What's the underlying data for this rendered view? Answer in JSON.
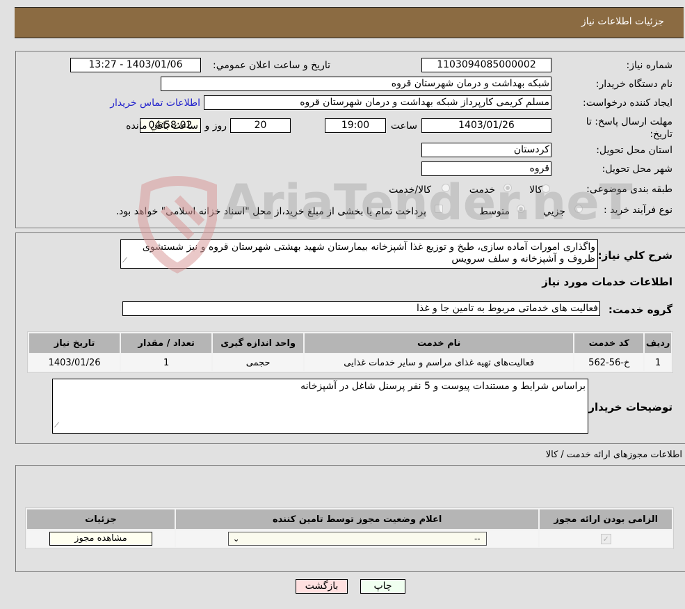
{
  "header": {
    "title": "جزئیات اطلاعات نیاز"
  },
  "details": {
    "need_number_label": "شماره نیاز:",
    "need_number": "1103094085000002",
    "announce_label": "تاریخ و ساعت اعلان عمومي:",
    "announce_value": "1403/01/06 - 13:27",
    "buyer_org_label": "نام دستگاه خریدار:",
    "buyer_org": "شبکه بهداشت و درمان شهرستان قروه",
    "requester_label": "ایجاد کننده درخواست:",
    "requester": "مسلم کریمی کارپرداز شبکه بهداشت و درمان شهرستان قروه",
    "contact_link": "اطلاعات تماس خریدار",
    "deadline_label": "مهلت ارسال پاسخ: تا تاریخ:",
    "deadline_date": "1403/01/26",
    "time_label": "ساعت",
    "deadline_time": "19:00",
    "days_value": "20",
    "days_label": "روز و",
    "remaining_time": "04:58:02",
    "remaining_label": "ساعت باقي مانده",
    "province_label": "استان محل تحویل:",
    "province": "کردستان",
    "city_label": "شهر محل تحویل:",
    "city": "قروه",
    "category_label": "طبقه بندی موضوعی:",
    "category_options": [
      {
        "label": "کالا",
        "checked": false
      },
      {
        "label": "خدمت",
        "checked": true
      },
      {
        "label": "کالا/خدمت",
        "checked": false
      }
    ],
    "process_label": "نوع فرآیند خرید :",
    "process_options": [
      {
        "label": "جزیي",
        "checked": false
      },
      {
        "label": "متوسط",
        "checked": true
      }
    ],
    "treasury_note": "پرداخت تمام یا بخشی از مبلغ خرید،از محل \"اسناد خزانه اسلامی\" خواهد بود.",
    "treasury_checked": false
  },
  "description": {
    "label": "شرح كلي نياز:",
    "text": "واگذاری امورات آماده سازی، طبخ و توزیع غذا آشپزخانه بیمارستان شهید بهشتی شهرستان قروه و نیز شستشوی ظروف و آشپزخانه و سلف سرویس"
  },
  "services": {
    "section_title": "اطلاعات خدمات مورد نیاز",
    "group_label": "گروه خدمت:",
    "group_value": "فعالیت های خدماتی مربوط به تامین جا و غذا",
    "columns": [
      "ردیف",
      "کد خدمت",
      "نام خدمت",
      "واحد اندازه گیری",
      "تعداد / مقدار",
      "تاریخ نیاز"
    ],
    "rows": [
      [
        "1",
        "خ-56-562",
        "فعالیت‌های تهیه غذای مراسم و سایر خدمات غذایی",
        "حجمی",
        "1",
        "1403/01/26"
      ]
    ]
  },
  "buyer_notes": {
    "label": "توضیحات خریدار:",
    "text": "براساس شرایط و مستندات پیوست و 5 نفر پرسنل شاغل در آشپزخانه"
  },
  "licenses": {
    "section_title": "اطلاعات مجوزهای ارائه خدمت / کالا",
    "columns": [
      "الزامی بودن ارائه مجوز",
      "اعلام وضعیت مجوز توسط تامین کننده",
      "جزئیات"
    ],
    "rows": [
      {
        "required": true,
        "status_selected": "--",
        "details_button": "مشاهده مجوز"
      }
    ]
  },
  "footer": {
    "print_button": "چاپ",
    "back_button": "بازگشت"
  },
  "watermark": {
    "text": "AriaTender.neT"
  }
}
